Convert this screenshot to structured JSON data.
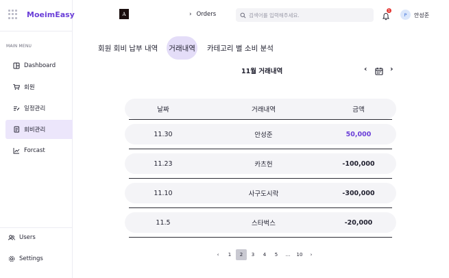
{
  "app": {
    "name": "MoeimEasy"
  },
  "sidebar": {
    "caption": "MAIN MENU",
    "items": [
      {
        "label": "Dashboard",
        "icon": "dashboard-icon"
      },
      {
        "label": "회원",
        "icon": "cart-icon"
      },
      {
        "label": "일정관리",
        "icon": "schedule-icon"
      },
      {
        "label": "회비관리",
        "icon": "document-icon",
        "active": true
      },
      {
        "label": "Forcast",
        "icon": "chart-icon"
      }
    ],
    "bottom": [
      {
        "label": "Users",
        "icon": "users-icon"
      },
      {
        "label": "Settings",
        "icon": "gear-icon"
      }
    ]
  },
  "header": {
    "logo_letter": "A",
    "breadcrumb": "Orders",
    "search_placeholder": "검색어를 입력해주세요.",
    "notification_count": "1",
    "avatar_letter": "P",
    "user_name": "안성준"
  },
  "tabs": [
    {
      "label": "회원 회비 납부 내역"
    },
    {
      "label": "거래내역",
      "active": true
    },
    {
      "label": "카테고리 별 소비 분석"
    }
  ],
  "month": {
    "title": "11월 거래내역"
  },
  "table": {
    "columns": [
      "날짜",
      "거래내역",
      "금액"
    ],
    "rows": [
      {
        "date": "11.30",
        "desc": "안성준",
        "amount": "50,000"
      },
      {
        "date": "11.23",
        "desc": "카츠헌",
        "amount": "-100,000"
      },
      {
        "date": "11.10",
        "desc": "사구도시락",
        "amount": "-300,000"
      },
      {
        "date": "11.5",
        "desc": "스타벅스",
        "amount": "-20,000"
      }
    ]
  },
  "pagination": {
    "prev": "‹",
    "next": "›",
    "pages": [
      "1",
      "2",
      "3",
      "4",
      "5",
      "...",
      "10"
    ],
    "current": "2"
  },
  "colors": {
    "accent": "#6b3fd8",
    "active_bg": "#ece6fb"
  }
}
